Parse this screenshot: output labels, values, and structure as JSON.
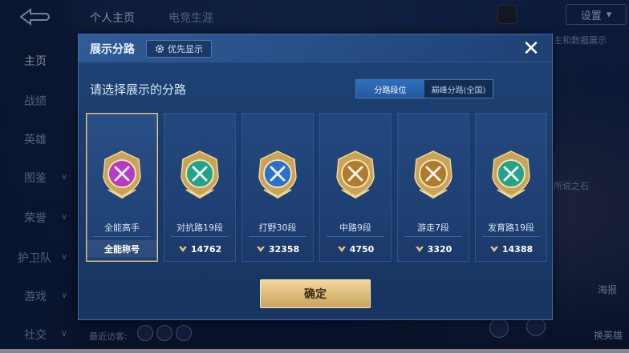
{
  "background": {
    "nav": [
      "主页",
      "战绩",
      "英雄",
      "图鉴",
      "荣誉",
      "护卫队",
      "游戏",
      "社交"
    ],
    "top_tabs": [
      "个人主页",
      "电竞生涯"
    ],
    "settings_label": "设置",
    "right_snippet_1": "主和数据展示",
    "right_snippet_2": "所说之石",
    "right_button_1": "海报",
    "right_button_2": "换英雄",
    "bottom_text": "最近访客:"
  },
  "modal": {
    "title": "展示分路",
    "priority_label": "优先显示",
    "close_label": "✕",
    "subtitle": "请选择展示的分路",
    "toggle": {
      "active": "分路段位",
      "inactive": "巅峰分路(全国)"
    },
    "confirm_label": "确定",
    "cards": [
      {
        "name": "全能高手",
        "footer": "全能称号",
        "selected": true,
        "color": "#b43bc4"
      },
      {
        "name": "对抗路19段",
        "footer": "14762",
        "selected": false,
        "color": "#23a389"
      },
      {
        "name": "打野30段",
        "footer": "32358",
        "selected": false,
        "color": "#2a6fc9"
      },
      {
        "name": "中路9段",
        "footer": "4750",
        "selected": false,
        "color": "#b07b2c"
      },
      {
        "name": "游走7段",
        "footer": "3320",
        "selected": false,
        "color": "#b07b2c"
      },
      {
        "name": "发育路19段",
        "footer": "14388",
        "selected": false,
        "color": "#23a389"
      }
    ]
  },
  "colors": {
    "accent_gold": "#e9c887",
    "panel": "#1f4478",
    "confirm": "#d8b66f"
  }
}
